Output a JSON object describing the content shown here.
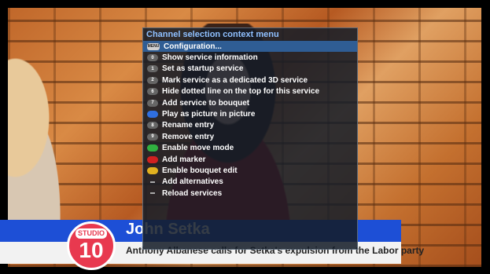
{
  "menu": {
    "title": "Channel selection context menu",
    "items": [
      {
        "label": "Configuration...",
        "key": "MENU",
        "key_type": "menu",
        "key_color": "#d0d0d0",
        "selected": true
      },
      {
        "label": "Show service information",
        "key": "0",
        "key_type": "number",
        "key_color": "#666666",
        "selected": false
      },
      {
        "label": "Set as startup service",
        "key": "1",
        "key_type": "number",
        "key_color": "#666666",
        "selected": false
      },
      {
        "label": "Mark service as a dedicated 3D service",
        "key": "2",
        "key_type": "number",
        "key_color": "#666666",
        "selected": false
      },
      {
        "label": "Hide dotted line on the top for this service",
        "key": "6",
        "key_type": "number",
        "key_color": "#666666",
        "selected": false
      },
      {
        "label": "Add service to bouquet",
        "key": "7",
        "key_type": "number",
        "key_color": "#666666",
        "selected": false
      },
      {
        "label": "Play as picture in picture",
        "key": "",
        "key_type": "color",
        "key_color": "#2f6fe0",
        "selected": false
      },
      {
        "label": "Rename entry",
        "key": "8",
        "key_type": "number",
        "key_color": "#666666",
        "selected": false
      },
      {
        "label": "Remove entry",
        "key": "9",
        "key_type": "number",
        "key_color": "#666666",
        "selected": false
      },
      {
        "label": "Enable move mode",
        "key": "",
        "key_type": "color",
        "key_color": "#30b040",
        "selected": false
      },
      {
        "label": "Add marker",
        "key": "",
        "key_type": "color",
        "key_color": "#d02020",
        "selected": false
      },
      {
        "label": "Enable bouquet edit",
        "key": "",
        "key_type": "color",
        "key_color": "#e0b020",
        "selected": false
      },
      {
        "label": "Add alternatives",
        "key": "",
        "key_type": "dash",
        "key_color": "#aaaaaa",
        "selected": false
      },
      {
        "label": "Reload services",
        "key": "",
        "key_type": "dash",
        "key_color": "#aaaaaa",
        "selected": false
      }
    ]
  },
  "overlay": {
    "logo_top": "STUDIO",
    "logo_number": "10",
    "name": "John Setka",
    "headline": "Anthony Albanese calls for Setka's expulsion from the Labor party"
  }
}
